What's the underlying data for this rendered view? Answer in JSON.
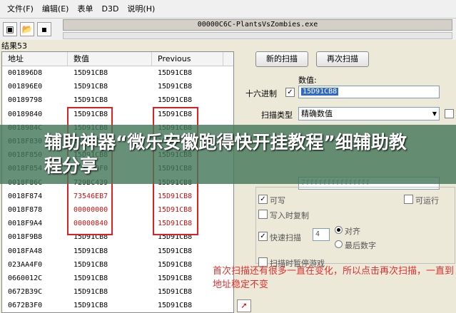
{
  "menu": [
    "文件(F)",
    "编辑(E)",
    "表单",
    "D3D",
    "说明(H)"
  ],
  "toolbar": {
    "icons": [
      "computer-icon",
      "open-folder-icon",
      "save-icon"
    ]
  },
  "process": {
    "title": "00000C6C-PlantsVsZombies.exe"
  },
  "results": {
    "found_label": "结果53",
    "columns": [
      "地址",
      "数值",
      "Previous"
    ],
    "rows": [
      {
        "address": "001896D8",
        "value": "15D91CB8",
        "previous": "15D91CB8",
        "changed": false
      },
      {
        "address": "001896E0",
        "value": "15D91CB8",
        "previous": "15D91CB8",
        "changed": false
      },
      {
        "address": "00189798",
        "value": "15D91CB8",
        "previous": "15D91CB8",
        "changed": false
      },
      {
        "address": "00189840",
        "value": "15D91CB8",
        "previous": "15D91CB8",
        "changed": false
      },
      {
        "address": "0018984C",
        "value": "15D91CB8",
        "previous": "15D91CB8",
        "changed": false
      },
      {
        "address": "0018F830",
        "value": "15D91CB8",
        "previous": "15D91CB8",
        "changed": false
      },
      {
        "address": "0018F850",
        "value": "15D91CB8",
        "previous": "15D91CB8",
        "changed": false
      },
      {
        "address": "0018F854",
        "value": "0018F9F0",
        "previous": "15D91CB8",
        "changed": false
      },
      {
        "address": "0018F86C",
        "value": "729BC439",
        "previous": "15D91CB8",
        "changed": false
      },
      {
        "address": "0018F874",
        "value": "73546EB7",
        "previous": "15D91CB8",
        "changed": true
      },
      {
        "address": "0018F878",
        "value": "00000000",
        "previous": "15D91CB8",
        "changed": true
      },
      {
        "address": "0018F9A4",
        "value": "00000840",
        "previous": "15D91CB8",
        "changed": true
      },
      {
        "address": "0018F9B8",
        "value": "15D91CB8",
        "previous": "15D91CB8",
        "changed": false
      },
      {
        "address": "0018FA48",
        "value": "15D91CB8",
        "previous": "15D91CB8",
        "changed": false
      },
      {
        "address": "023AA4F0",
        "value": "15D91CB8",
        "previous": "15D91CB8",
        "changed": false
      },
      {
        "address": "0660012C",
        "value": "15D91CB8",
        "previous": "15D91CB8",
        "changed": false
      },
      {
        "address": "0672B39C",
        "value": "15D91CB8",
        "previous": "15D91CB8",
        "changed": false
      },
      {
        "address": "0672B3F0",
        "value": "15D91CB8",
        "previous": "15D91CB8",
        "changed": false
      }
    ]
  },
  "scan": {
    "new_scan": "新的扫描",
    "next_scan": "再次扫描",
    "value_label": "数值:",
    "hex_label": "十六进制",
    "value": "15D91CB8",
    "scan_type_label": "扫描类型",
    "scan_type": "精确数值",
    "range_end": "7fffffffffffffff",
    "writable": "可写",
    "executable": "可运行",
    "copy_on_write": "写入时复制",
    "fast_scan": "快速扫描",
    "fast_scan_value": "4",
    "align": "对齐",
    "last_digits": "最后数字",
    "pause_game": "扫描时暂停游戏"
  },
  "banner": {
    "title": "辅助神器“微乐安徽跑得快开挂教程”细辅助教程分享"
  },
  "note": {
    "text": "首次扫描还有很多一直在变化，所以点击再次扫描，一直到地址稳定不变"
  }
}
